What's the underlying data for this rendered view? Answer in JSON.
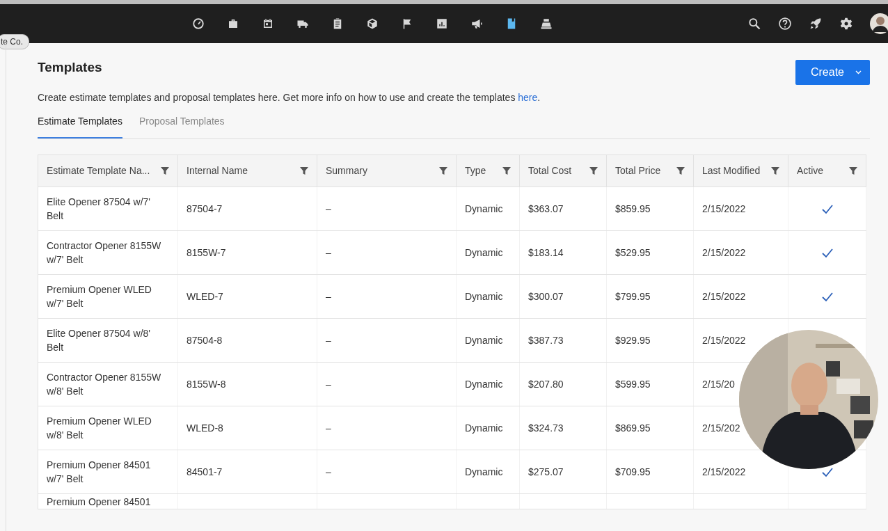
{
  "navbar": {
    "company_badge": "te Co.",
    "apps": [
      {
        "kind": "gauge",
        "selected": false
      },
      {
        "kind": "briefcase",
        "selected": false
      },
      {
        "kind": "calendar",
        "selected": false
      },
      {
        "kind": "truck",
        "selected": false
      },
      {
        "kind": "clipboard",
        "selected": false
      },
      {
        "kind": "cube",
        "selected": false
      },
      {
        "kind": "flag",
        "selected": false
      },
      {
        "kind": "chart",
        "selected": false
      },
      {
        "kind": "megaphone",
        "selected": false
      },
      {
        "kind": "book",
        "selected": true
      },
      {
        "kind": "register",
        "selected": false
      }
    ],
    "tools": [
      {
        "kind": "search"
      },
      {
        "kind": "help"
      },
      {
        "kind": "rocket"
      },
      {
        "kind": "settings"
      },
      {
        "kind": "avatar"
      }
    ]
  },
  "page": {
    "title": "Templates",
    "create_button": "Create",
    "description": "Create estimate templates and proposal templates here. Get more info on how to use and create the templates ",
    "description_link": "here",
    "description_end": "."
  },
  "tabs": [
    {
      "label": "Estimate Templates",
      "selected": true
    },
    {
      "label": "Proposal Templates",
      "selected": false
    }
  ],
  "table": {
    "columns": [
      "Estimate Template Na...",
      "Internal Name",
      "Summary",
      "Type",
      "Total Cost",
      "Total Price",
      "Last Modified",
      "Active"
    ],
    "rows": [
      {
        "name": "Elite Opener 87504 w/7' Belt",
        "internal_name": "87504-7",
        "summary": "–",
        "type": "Dynamic",
        "total_cost": "$363.07",
        "total_price": "$859.95",
        "last_modified": "2/15/2022",
        "active": true
      },
      {
        "name": "Contractor Opener 8155W w/7' Belt",
        "internal_name": "8155W-7",
        "summary": "–",
        "type": "Dynamic",
        "total_cost": "$183.14",
        "total_price": "$529.95",
        "last_modified": "2/15/2022",
        "active": true
      },
      {
        "name": "Premium Opener WLED w/7' Belt",
        "internal_name": "WLED-7",
        "summary": "–",
        "type": "Dynamic",
        "total_cost": "$300.07",
        "total_price": "$799.95",
        "last_modified": "2/15/2022",
        "active": true
      },
      {
        "name": "Elite Opener 87504 w/8' Belt",
        "internal_name": "87504-8",
        "summary": "–",
        "type": "Dynamic",
        "total_cost": "$387.73",
        "total_price": "$929.95",
        "last_modified": "2/15/2022"
      },
      {
        "name": "Contractor Opener 8155W w/8' Belt",
        "internal_name": "8155W-8",
        "summary": "–",
        "type": "Dynamic",
        "total_cost": "$207.80",
        "total_price": "$599.95",
        "last_modified": "2/15/20"
      },
      {
        "name": "Premium Opener WLED w/8' Belt",
        "internal_name": "WLED-8",
        "summary": "–",
        "type": "Dynamic",
        "total_cost": "$324.73",
        "total_price": "$869.95",
        "last_modified": "2/15/202"
      },
      {
        "name": "Premium Opener 84501 w/7' Belt",
        "internal_name": "84501-7",
        "summary": "–",
        "type": "Dynamic",
        "total_cost": "$275.07",
        "total_price": "$709.95",
        "last_modified": "2/15/2022",
        "active": true
      },
      {
        "name": "Premium Opener 84501"
      }
    ]
  }
}
